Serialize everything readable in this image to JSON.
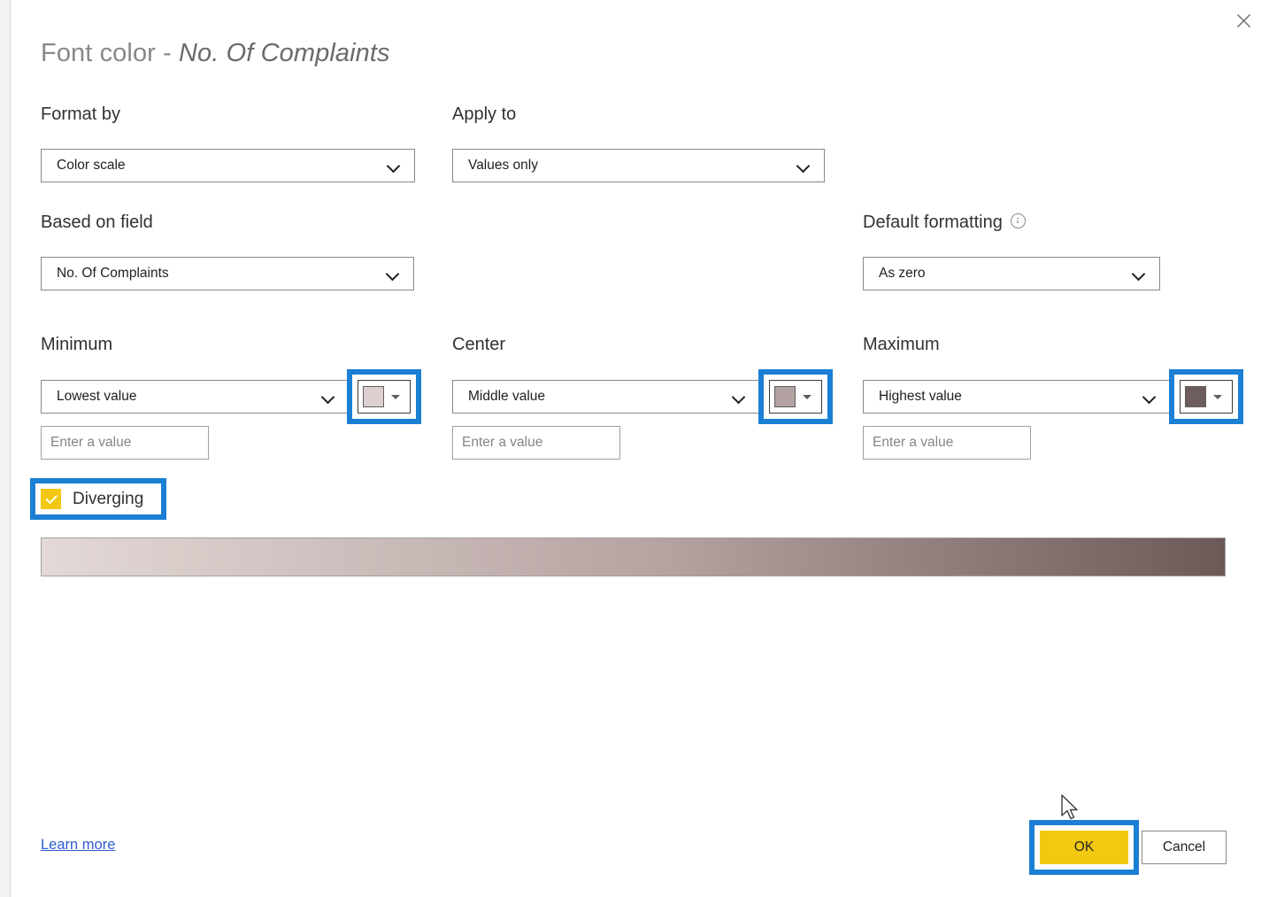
{
  "dialog": {
    "title_prefix": "Font color - ",
    "title_field": "No. Of Complaints",
    "close_icon": "close-icon"
  },
  "fields": {
    "format_by": {
      "label": "Format by",
      "value": "Color scale"
    },
    "apply_to": {
      "label": "Apply to",
      "value": "Values only"
    },
    "based_on_field": {
      "label": "Based on field",
      "value": "No. Of Complaints"
    },
    "default_formatting": {
      "label": "Default formatting",
      "info_icon": "info-icon",
      "value": "As zero"
    }
  },
  "scale": {
    "minimum": {
      "label": "Minimum",
      "value": "Lowest value",
      "placeholder": "Enter a value",
      "input_value": "",
      "swatch_color": "#ded0d1",
      "swatch_caret_icon": "chevron-down-icon"
    },
    "center": {
      "label": "Center",
      "value": "Middle value",
      "placeholder": "Enter a value",
      "input_value": "",
      "swatch_color": "#b4a1a1",
      "swatch_caret_icon": "chevron-down-icon"
    },
    "maximum": {
      "label": "Maximum",
      "value": "Highest value",
      "placeholder": "Enter a value",
      "input_value": "",
      "swatch_color": "#6e5d5d",
      "swatch_caret_icon": "chevron-down-icon"
    },
    "diverging": {
      "label": "Diverging",
      "checked": true,
      "check_icon": "checkmark-icon",
      "checkbox_color": "#f2c812"
    },
    "gradient_preview": {
      "from": "#e3d9d6",
      "mid": "#b6a3a2",
      "to": "#6b5a58"
    }
  },
  "footer": {
    "learn_more": "Learn more",
    "ok": "OK",
    "cancel": "Cancel"
  },
  "annotations": {
    "highlight_color": "#1b7fd4"
  }
}
